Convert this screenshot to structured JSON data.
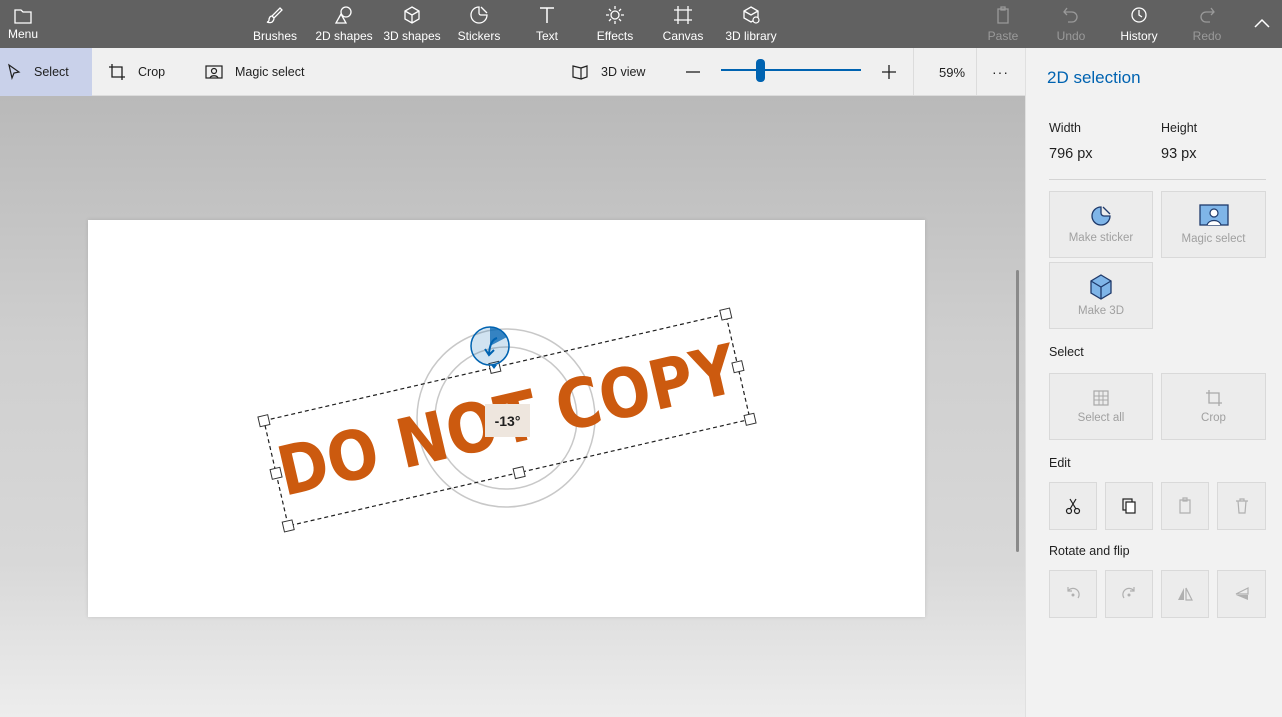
{
  "topbar": {
    "menu_label": "Menu",
    "tools": [
      {
        "label": "Brushes",
        "icon": "brush-icon"
      },
      {
        "label": "2D shapes",
        "icon": "2d-shapes-icon"
      },
      {
        "label": "3D shapes",
        "icon": "3d-shapes-icon"
      },
      {
        "label": "Stickers",
        "icon": "sticker-icon"
      },
      {
        "label": "Text",
        "icon": "text-icon"
      },
      {
        "label": "Effects",
        "icon": "effects-icon"
      },
      {
        "label": "Canvas",
        "icon": "canvas-icon"
      },
      {
        "label": "3D library",
        "icon": "3d-library-icon"
      }
    ],
    "actions": [
      {
        "label": "Paste",
        "icon": "paste-icon",
        "enabled": false
      },
      {
        "label": "Undo",
        "icon": "undo-icon",
        "enabled": false
      },
      {
        "label": "History",
        "icon": "history-icon",
        "enabled": true
      },
      {
        "label": "Redo",
        "icon": "redo-icon",
        "enabled": false
      }
    ]
  },
  "toolbar2": {
    "select_label": "Select",
    "crop_label": "Crop",
    "magic_select_label": "Magic select",
    "view3d_label": "3D view",
    "zoom_value": "59%",
    "zoom_fraction": 0.28,
    "more_label": "···"
  },
  "canvas": {
    "stamp_text": "DO NOT COPY",
    "rotation_label": "-13°",
    "rotation_degrees": -13,
    "text_color": "#cc5a0f"
  },
  "panel": {
    "title": "2D selection",
    "width_label": "Width",
    "width_value": "796 px",
    "height_label": "Height",
    "height_value": "93 px",
    "make_sticker_label": "Make sticker",
    "magic_select_label": "Magic select",
    "make_3d_label": "Make 3D",
    "select_section": "Select",
    "select_all_label": "Select all",
    "crop_label": "Crop",
    "edit_section": "Edit",
    "rotate_section": "Rotate and flip"
  },
  "colors": {
    "accent": "#0063b1",
    "topbar": "#616161"
  }
}
